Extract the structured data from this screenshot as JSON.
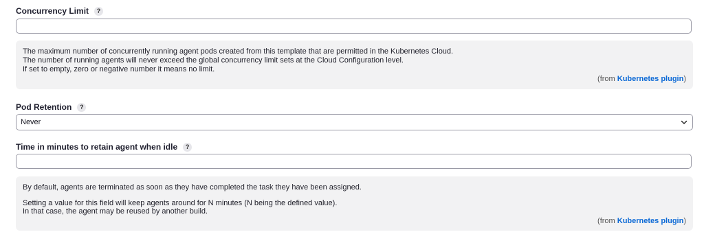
{
  "concurrency": {
    "label": "Concurrency Limit",
    "help": "?",
    "value": "",
    "info_lines": [
      "The maximum number of concurrently running agent pods created from this template that are permitted in the Kubernetes Cloud.",
      "The number of running agents will never exceed the global concurrency limit sets at the Cloud Configuration level.",
      "If set to empty, zero or negative number it means no limit."
    ],
    "from_prefix": "(from ",
    "from_link": "Kubernetes plugin",
    "from_suffix": ")"
  },
  "pod_retention": {
    "label": "Pod Retention",
    "help": "?",
    "selected": "Never"
  },
  "idle_time": {
    "label": "Time in minutes to retain agent when idle",
    "help": "?",
    "value": "",
    "info_lines": [
      "By default, agents are terminated as soon as they have completed the task they have been assigned.",
      "Setting a value for this field will keep agents around for N minutes (N being the defined value).",
      "In that case, the agent may be reused by another build."
    ],
    "from_prefix": "(from ",
    "from_link": "Kubernetes plugin",
    "from_suffix": ")"
  }
}
